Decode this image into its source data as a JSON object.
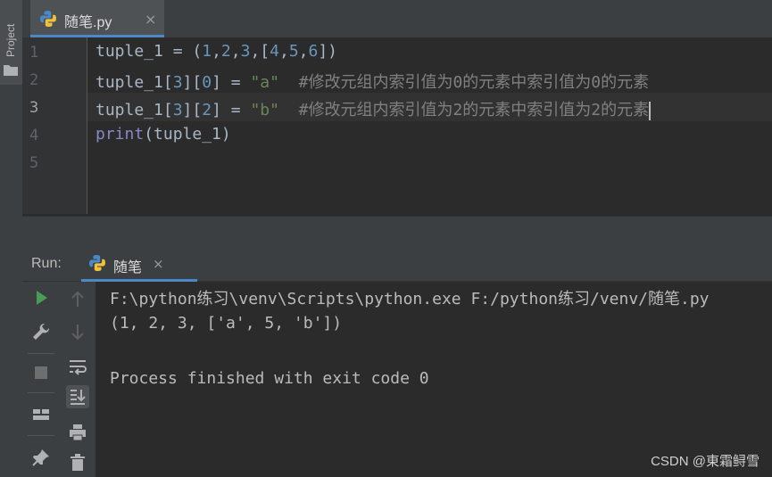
{
  "sidebar": {
    "project_label": "Project"
  },
  "editor_tab": {
    "file_name": "随笔.py",
    "close_glyph": "×"
  },
  "editor": {
    "line_numbers": [
      "1",
      "2",
      "3",
      "4",
      "5"
    ],
    "lines": [
      {
        "a": "tuple_1 = (",
        "n1": "1",
        "c1": ",",
        "n2": "2",
        "c2": ",",
        "n3": "3",
        "c3": ",[",
        "n4": "4",
        "c4": ",",
        "n5": "5",
        "c5": ",",
        "n6": "6",
        "end": "])"
      },
      {
        "a": "tuple_1[",
        "n1": "3",
        "b": "][",
        "n2": "0",
        "c": "] = ",
        "s": "\"a\"",
        "comment": "  #修改元组内索引值为0的元素中索引值为0的元素"
      },
      {
        "a": "tuple_1[",
        "n1": "3",
        "b": "][",
        "n2": "2",
        "c": "] = ",
        "s": "\"b\"",
        "comment": "  #修改元组内索引值为2的元素中索引值为2的元素"
      },
      {
        "fn": "print",
        "args": "(tuple_1)"
      }
    ]
  },
  "run_panel": {
    "label": "Run:",
    "tab_name": "随笔",
    "close_glyph": "×",
    "output": [
      "F:\\python练习\\venv\\Scripts\\python.exe F:/python练习/venv/随笔.py",
      "(1, 2, 3, ['a', 5, 'b'])",
      "",
      "Process finished with exit code 0"
    ]
  },
  "icons": {
    "run": "play-icon",
    "settings": "wrench-icon",
    "stop": "stop-icon",
    "layout": "layout-icon",
    "pin": "pin-icon",
    "up": "arrow-up-icon",
    "down": "arrow-down-icon",
    "wrap": "soft-wrap-icon",
    "scroll_end": "scroll-to-end-icon",
    "print": "print-icon",
    "trash": "trash-icon"
  },
  "colors": {
    "accent": "#4a88c7",
    "run_green": "#499c54",
    "keyword_blue": "#6897bb",
    "string_green": "#6a8759"
  },
  "watermark": "CSDN @東霜鲟雪"
}
